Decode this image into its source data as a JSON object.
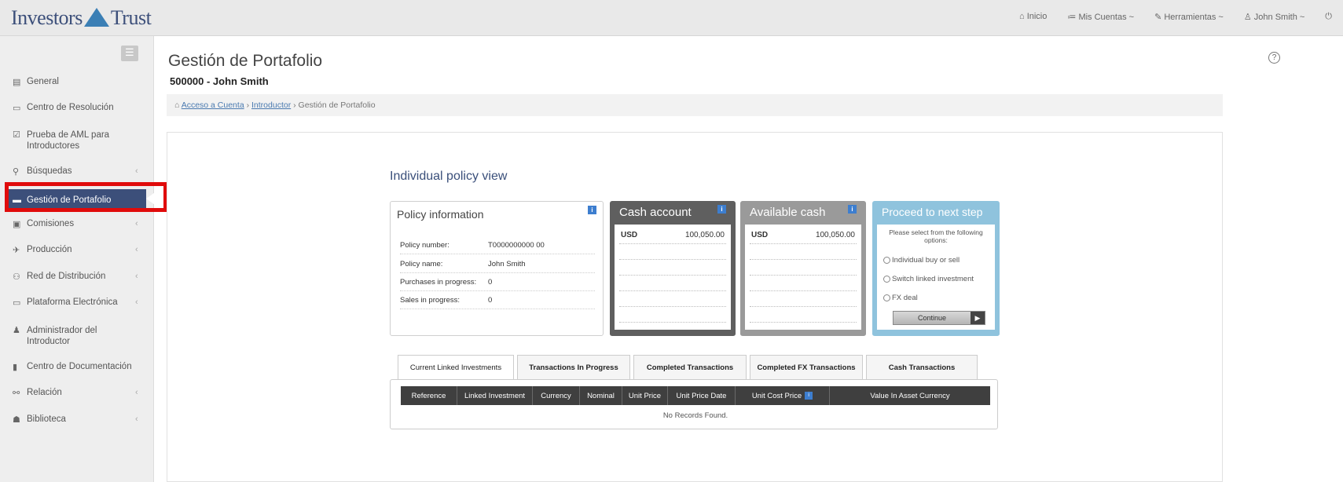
{
  "header": {
    "brand": "Investors Trust",
    "brand_left": "Investors",
    "brand_right": "Trust",
    "nav": [
      "Inicio",
      "Mis Cuentas ~",
      "Herramientas ~",
      "John Smith ~"
    ]
  },
  "sidebar": {
    "items": [
      {
        "label": "General",
        "icon": "calendar-icon"
      },
      {
        "label": "Centro de Resolución",
        "icon": "monitor-icon"
      },
      {
        "label": "Prueba de AML para Introductores",
        "icon": "test-icon"
      },
      {
        "label": "Búsquedas",
        "icon": "search-icon"
      },
      {
        "label": "Gestión de Portafolio",
        "icon": "portfolio-icon"
      },
      {
        "label": "Comisiones",
        "icon": "money-icon"
      },
      {
        "label": "Producción",
        "icon": "plane-icon"
      },
      {
        "label": "Red de Distribución",
        "icon": "network-icon"
      },
      {
        "label": "Plataforma Electrónica",
        "icon": "screen-icon"
      },
      {
        "label": "Administrador del Introductor",
        "icon": "users-icon"
      },
      {
        "label": "Centro de Documentación",
        "icon": "file-icon"
      },
      {
        "label": "Relación",
        "icon": "relation-icon"
      },
      {
        "label": "Biblioteca",
        "icon": "library-icon"
      }
    ]
  },
  "page": {
    "title": "Gestión de Portafolio",
    "subtitle": "500000 - John Smith",
    "breadcrumb": [
      "Acceso a Cuenta",
      "Introductor",
      "Gestión de Portafolio"
    ]
  },
  "policy_view": {
    "title": "Individual policy view",
    "policy_info": {
      "title": "Policy information",
      "rows": [
        {
          "k": "Policy number:",
          "v": "T0000000000 00"
        },
        {
          "k": "Policy name:",
          "v": "John Smith"
        },
        {
          "k": "Purchases in progress:",
          "v": "0"
        },
        {
          "k": "Sales in progress:",
          "v": "0"
        }
      ]
    },
    "cash_account": {
      "title": "Cash account",
      "currency": "USD",
      "amount": "100,050.00"
    },
    "available_cash": {
      "title": "Available cash",
      "currency": "USD",
      "amount": "100,050.00"
    },
    "next_step": {
      "title": "Proceed to next step",
      "text": "Please select from the following options:",
      "options": [
        "Individual buy or sell",
        "Switch linked investment",
        "FX deal"
      ],
      "button": "Continue"
    }
  },
  "tabs": [
    "Current Linked Investments",
    "Transactions In Progress",
    "Completed Transactions",
    "Completed FX Transactions",
    "Cash Transactions"
  ],
  "grid": {
    "columns": [
      "Reference",
      "Linked Investment",
      "Currency",
      "Nominal",
      "Unit Price",
      "Unit Price Date",
      "Unit Cost Price",
      "Value In Asset Currency"
    ],
    "empty": "No Records Found."
  },
  "colors": {
    "active_nav": "#3c4f7a",
    "highlight": "#e00b0b",
    "cash": "#5f5f5f",
    "available": "#9a9a9a",
    "next": "#8fc3dd"
  }
}
